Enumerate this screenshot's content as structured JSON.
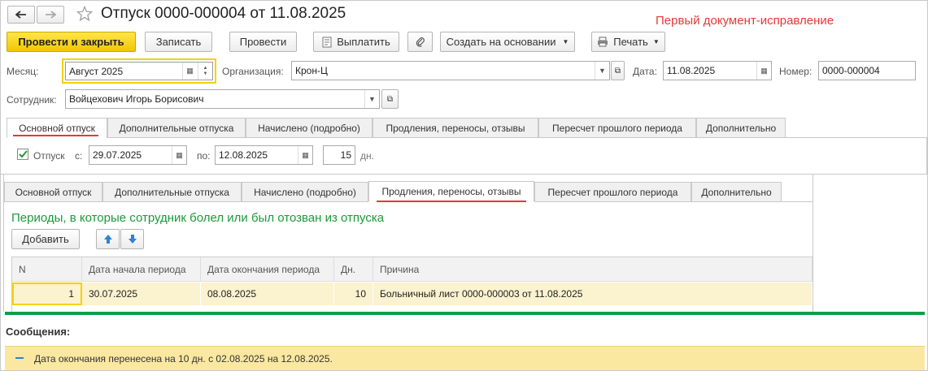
{
  "window": {
    "title": "Отпуск 0000-000004 от 11.08.2025",
    "annotation": "Первый документ-исправление"
  },
  "toolbar": {
    "post_close": "Провести и закрыть",
    "save": "Записать",
    "post": "Провести",
    "pay": "Выплатить",
    "create_based": "Создать на основании",
    "print": "Печать"
  },
  "form": {
    "month_label": "Месяц:",
    "month_value": "Август 2025",
    "org_label": "Организация:",
    "org_value": "Крон-Ц",
    "date_label": "Дата:",
    "date_value": "11.08.2025",
    "number_label": "Номер:",
    "number_value": "0000-000004",
    "employee_label": "Сотрудник:",
    "employee_value": "Войцехович Игорь Борисович"
  },
  "tabs": [
    "Основной отпуск",
    "Дополнительные отпуска",
    "Начислено (подробно)",
    "Продления, переносы, отзывы",
    "Пересчет прошлого периода",
    "Дополнительно"
  ],
  "vacation": {
    "checkbox_label": "Отпуск",
    "from_label": "с:",
    "from_value": "29.07.2025",
    "to_label": "по:",
    "to_value": "12.08.2025",
    "days_value": "15",
    "days_unit": "дн."
  },
  "extension": {
    "heading": "Периоды, в которые сотрудник болел или был отозван из отпуска",
    "add_button": "Добавить",
    "columns": [
      "N",
      "Дата начала периода",
      "Дата окончания периода",
      "Дн.",
      "Причина"
    ],
    "rows": [
      [
        "1",
        "30.07.2025",
        "08.08.2025",
        "10",
        "Больничный лист 0000-000003 от 11.08.2025"
      ]
    ]
  },
  "messages": {
    "title": "Сообщения:",
    "text": "Дата окончания перенесена на 10 дн. с 02.08.2025 на 12.08.2025."
  },
  "colors": {
    "accent_yellow": "#f5d100",
    "annotation_red": "#e53935",
    "heading_green": "#1a9a3a",
    "separator_green": "#109c48"
  }
}
